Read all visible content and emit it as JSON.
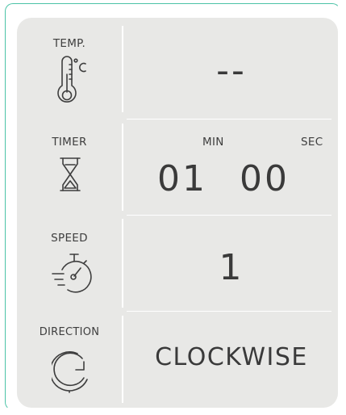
{
  "temperature": {
    "label": "TEMP.",
    "icon": "thermometer-celsius-icon",
    "value": "--"
  },
  "timer": {
    "label": "TIMER",
    "icon": "hourglass-icon",
    "min_label": "MIN",
    "sec_label": "SEC",
    "minutes": "01",
    "seconds": "00"
  },
  "speed": {
    "label": "SPEED",
    "icon": "stopwatch-speed-icon",
    "value": "1"
  },
  "direction": {
    "label": "DIRECTION",
    "icon": "rotate-clockwise-icon",
    "value": "CLOCKWISE"
  },
  "colors": {
    "accent": "#4cc3a7",
    "panel": "#e8e8e6",
    "text": "#3a3a3a"
  }
}
